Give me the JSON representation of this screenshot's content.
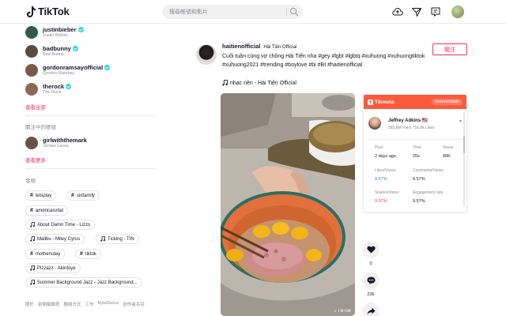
{
  "header": {
    "brand": "TikTok",
    "search_placeholder": "搜尋帳號和影片"
  },
  "sidebar": {
    "suggested": [
      {
        "name": "justinbieber",
        "sub": "Justin Bieber",
        "avatar_color": "#2f5b4a"
      },
      {
        "name": "badbunny",
        "sub": "Bad Bunny",
        "avatar_color": "#5a4a3f"
      },
      {
        "name": "gordonramsayofficial",
        "sub": "Gordon Ramsay",
        "avatar_color": "#7a5a47"
      },
      {
        "name": "therock",
        "sub": "The Rock",
        "avatar_color": "#8a6a55"
      }
    ],
    "see_all": "查看全部",
    "following_title": "關注中的帳號",
    "following": [
      {
        "name": "girlwiththemark",
        "sub": "Jordan Lacey",
        "avatar_color": "#6b5246"
      }
    ],
    "see_more": "查看更多",
    "discover_title": "發現",
    "discover": [
      {
        "type": "hashtag",
        "label": "letsplay"
      },
      {
        "type": "hashtag",
        "label": "sixfamily"
      },
      {
        "type": "hashtag",
        "label": "americasvital"
      },
      {
        "type": "music",
        "label": "About Damn Time - Lizzo"
      },
      {
        "type": "music",
        "label": "Malibu - Miley Cyrus"
      },
      {
        "type": "music",
        "label": "Ticking - TIN"
      },
      {
        "type": "hashtag",
        "label": "mothersday"
      },
      {
        "type": "hashtag",
        "label": "tiktok"
      },
      {
        "type": "music",
        "label": "Pizzazz - Akintoye"
      },
      {
        "type": "music",
        "label": "Summer Background Jazz - Jazz Background..."
      }
    ],
    "footer": [
      "關於",
      "新聞編輯室",
      "聯絡方式",
      "工作",
      "ByteDance",
      "創作者名目"
    ]
  },
  "post": {
    "username": "haitienofficial",
    "display_name": "Hải Tiến Official",
    "caption": "Cuối tuần cùng vợ chồng Hải Tiến nha #gey #lgbt #lgbtq #xuhuong #xuhuongtiktok #xuhuong2021 #trending #boylove #bi #BI #haitienofficial",
    "music": "nhạc nền - Hải Tiến Official",
    "follow_label": "關注",
    "like_count": "0",
    "comment_count": "236",
    "watermark": "♪ TikTok"
  },
  "tikmeta": {
    "brand": "Tikmeta",
    "badge": "Unreachable",
    "creator_name": "Jeffrey Adkins",
    "creator_flag": "🇺🇸",
    "creator_meta": "585.8M Fans    716.8k Likes",
    "stats": [
      {
        "label": "Post",
        "value": "2 days ago"
      },
      {
        "label": "Time",
        "value": "20s"
      },
      {
        "label": "Views",
        "value": "89K"
      },
      {
        "label": "Likes/Views",
        "value": "9.57%",
        "tone": "blue"
      },
      {
        "label": "Comments/Views",
        "value": "9.57%"
      },
      {
        "label": "Shares/Views",
        "value": "9.57%",
        "tone": "red"
      },
      {
        "label": "Engagement rate",
        "value": "9.57%"
      }
    ]
  },
  "colors": {
    "brand_red": "#fe2c55",
    "verified": "#20d5ec",
    "tikmeta_orange": "#fd5a3d"
  }
}
